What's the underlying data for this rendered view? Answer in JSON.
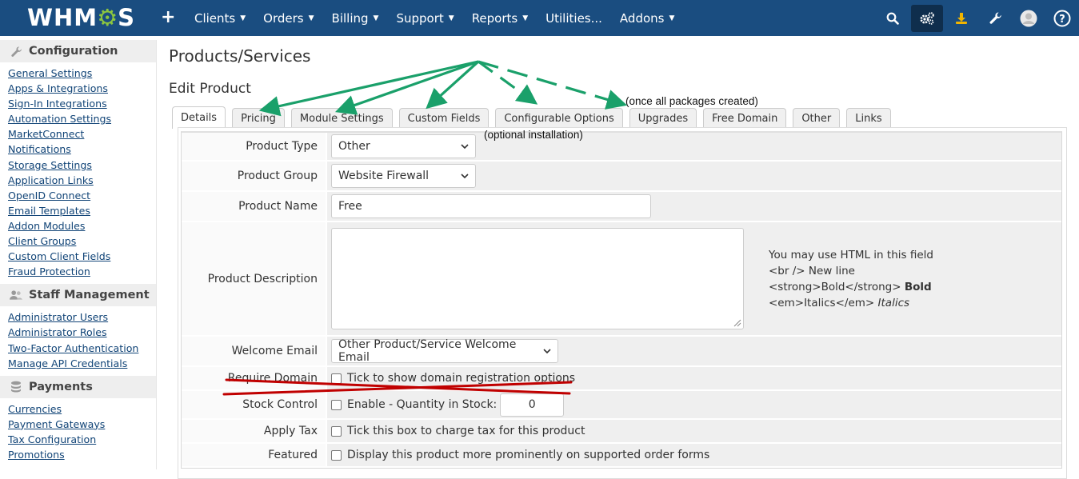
{
  "topbar": {
    "logo_text": "WHMCS",
    "plus": "+",
    "menu": [
      {
        "label": "Clients",
        "caret": "▼"
      },
      {
        "label": "Orders",
        "caret": "▼"
      },
      {
        "label": "Billing",
        "caret": "▼"
      },
      {
        "label": "Support",
        "caret": "▼"
      },
      {
        "label": "Reports",
        "caret": "▼"
      },
      {
        "label": "Utilities...",
        "caret": ""
      },
      {
        "label": "Addons",
        "caret": "▼"
      }
    ],
    "icons": [
      "search-icon",
      "cogs-icon",
      "download-icon",
      "wrench-icon",
      "user-avatar-icon",
      "help-icon"
    ]
  },
  "sidebar": {
    "sections": [
      {
        "title": "Configuration",
        "icon": "wrench-icon",
        "links": [
          "General Settings",
          "Apps & Integrations",
          "Sign-In Integrations",
          "Automation Settings",
          "MarketConnect",
          "Notifications",
          "Storage Settings",
          "Application Links",
          "OpenID Connect",
          "Email Templates",
          "Addon Modules",
          "Client Groups",
          "Custom Client Fields",
          "Fraud Protection"
        ]
      },
      {
        "title": "Staff Management",
        "icon": "users-icon",
        "links": [
          "Administrator Users",
          "Administrator Roles",
          "Two-Factor Authentication",
          "Manage API Credentials"
        ]
      },
      {
        "title": "Payments",
        "icon": "coins-icon",
        "links": [
          "Currencies",
          "Payment Gateways",
          "Tax Configuration",
          "Promotions"
        ]
      }
    ]
  },
  "main": {
    "page_title": "Products/Services",
    "sub_title": "Edit Product",
    "tabs": [
      "Details",
      "Pricing",
      "Module Settings",
      "Custom Fields",
      "Configurable Options",
      "Upgrades",
      "Free Domain",
      "Other",
      "Links"
    ],
    "active_tab": "Details"
  },
  "form": {
    "product_type": {
      "label": "Product Type",
      "value": "Other"
    },
    "product_group": {
      "label": "Product Group",
      "value": "Website Firewall"
    },
    "product_name": {
      "label": "Product Name",
      "value": "Free"
    },
    "product_description": {
      "label": "Product Description",
      "help_1": "You may use HTML in this field",
      "help_2": "<br /> New line",
      "help_3_code": "<strong>Bold</strong> ",
      "help_3_result": "Bold",
      "help_4_code": "<em>Italics</em> ",
      "help_4_result": "Italics"
    },
    "welcome_email": {
      "label": "Welcome Email",
      "value": "Other Product/Service Welcome Email"
    },
    "require_domain": {
      "label": "Require Domain",
      "text": "Tick to show domain registration options",
      "checked": false
    },
    "stock_control": {
      "label": "Stock Control",
      "text": "Enable - Quantity in Stock:",
      "quantity": "0",
      "checked": false
    },
    "apply_tax": {
      "label": "Apply Tax",
      "text": "Tick this box to charge tax for this product",
      "checked": false
    },
    "featured": {
      "label": "Featured",
      "text": "Display this product more prominently on supported order forms",
      "checked": false
    }
  },
  "annotations": {
    "upgrades_note": "(once all packages created)",
    "configurable_note": "(optional installation)",
    "arrow_color": "#1aa06a",
    "strike_color": "#c00000"
  },
  "colors": {
    "nav_bg": "#1a4d80",
    "logo_accent": "#8cc63f",
    "link": "#114477",
    "download_icon": "#f0b400"
  }
}
